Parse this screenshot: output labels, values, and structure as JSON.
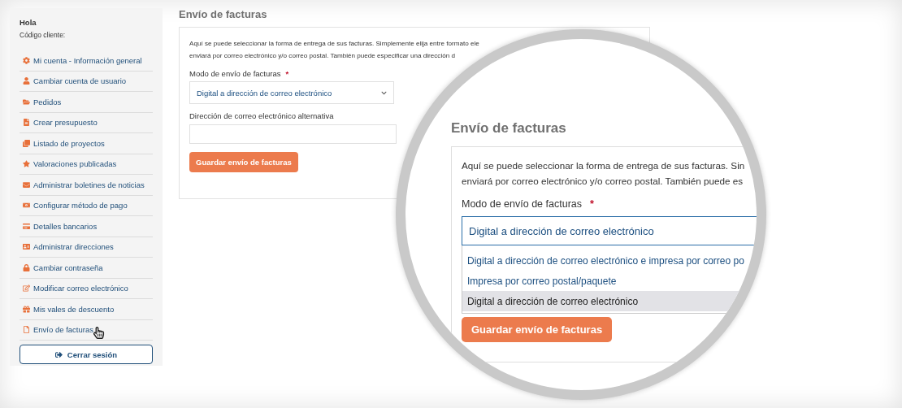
{
  "sidebar": {
    "greeting": "Hola",
    "customer_code_label": "Código cliente:",
    "items": [
      "Mi cuenta - Información general",
      "Cambiar cuenta de usuario",
      "Pedidos",
      "Crear presupuesto",
      "Listado de proyectos",
      "Valoraciones publicadas",
      "Administrar boletines de noticias",
      "Configurar método de pago",
      "Detalles bancarios",
      "Administrar direcciones",
      "Cambiar contraseña",
      "Modificar correo electrónico",
      "Mis vales de descuento",
      "Envío de facturas"
    ],
    "logout_button": "Cerrar sesión"
  },
  "main": {
    "title": "Envío de facturas",
    "intro_lines": [
      "Aquí se puede seleccionar la forma de entrega de sus facturas. Simplemente elija entre formato ele",
      "enviará por correo electrónico y/o correo postal. También puede especificar una dirección d"
    ],
    "mode_label": "Modo de envío de facturas",
    "required_mark": "*",
    "mode_select": {
      "value": "Digital a dirección de correo electrónico"
    },
    "alt_email_label": "Dirección de correo electrónico alternativa",
    "save_button": "Guardar envío de facturas"
  },
  "magnifier": {
    "title": "Envío de facturas",
    "intro_lines": [
      "Aquí se puede seleccionar la forma de entrega de sus facturas. Sin",
      "enviará por correo electrónico y/o correo postal. También puede es"
    ],
    "mode_label": "Modo de envío de facturas",
    "required_mark": "*",
    "mode_select": {
      "value": "Digital a dirección de correo electrónico",
      "options": [
        {
          "label": "Digital a dirección de correo electrónico e impresa por correo po",
          "selected": false
        },
        {
          "label": "Impresa por correo postal/paquete",
          "selected": false
        },
        {
          "label": "Digital a dirección de correo electrónico",
          "selected": true
        }
      ]
    },
    "save_button": "Guardar envío de facturas"
  }
}
